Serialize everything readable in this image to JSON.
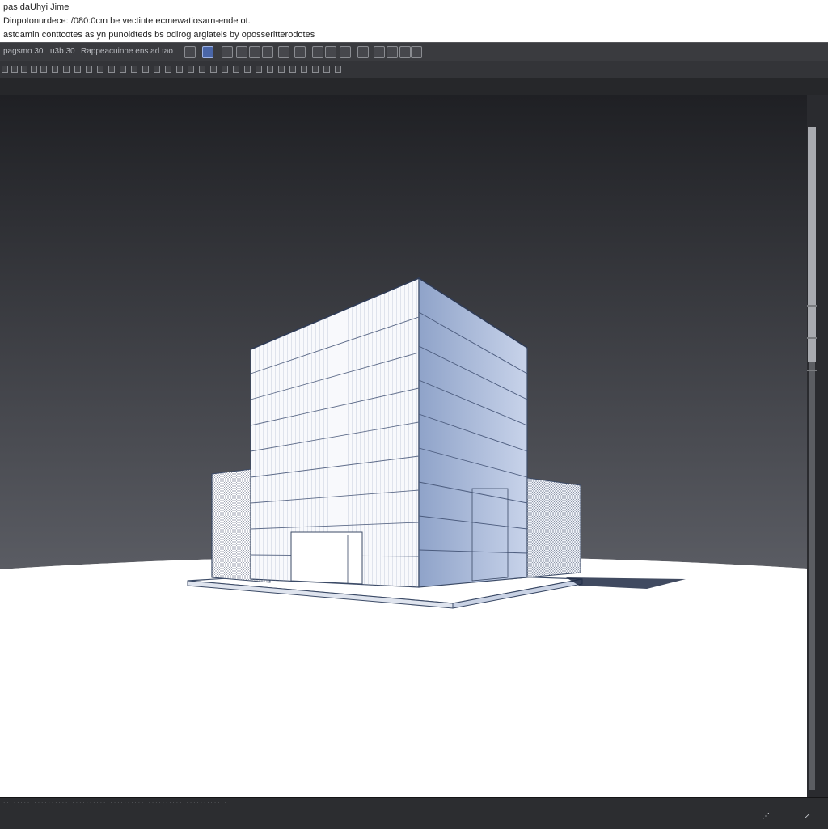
{
  "header": {
    "title": "pas daUhyi Jime",
    "line2": "Dinpotonurdece: /080:0cm be vectinte ecmewatiosarn-ende ot.",
    "line3": "astdamin conttcotes as yn punoldteds bs odlrog argiatels by oposseritterodotes"
  },
  "toolbar": {
    "label_a": "pagsmo   30",
    "label_b": "u3b  30",
    "label_c": "Rappeacuinne   ens   ad  tao",
    "active_tool_icon": "move-cursor-icon",
    "accent_color": "#4a66a8"
  },
  "viewport": {
    "sky_top_color": "#1f2024",
    "sky_bottom_color": "#5a5c63",
    "ground_color": "#ffffff",
    "model_stroke_color": "#3b4a66"
  },
  "status": {
    "left_text": "· · · · · · · · · · · · · · · · · · · · · · · · · · · · · · · · · · · · · · · · · · · · · · · · · · · · · · · · · · · · · · · · ·",
    "corner_icons": [
      "resize-grip-icon",
      "arrow-icon"
    ]
  }
}
